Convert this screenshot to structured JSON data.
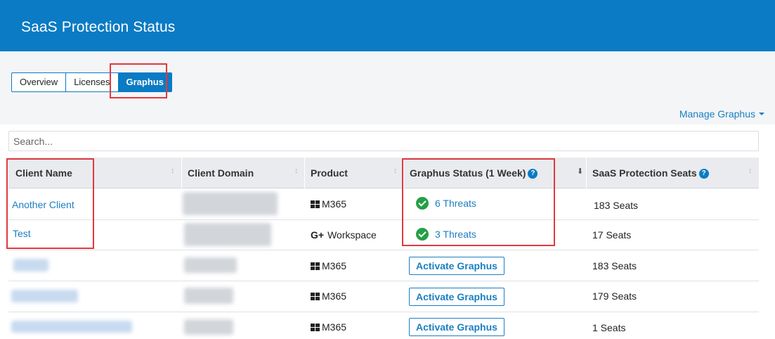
{
  "header": {
    "title": "SaaS Protection Status"
  },
  "tabs": [
    {
      "label": "Overview",
      "active": false
    },
    {
      "label": "Licenses",
      "active": false
    },
    {
      "label": "Graphus",
      "active": true
    }
  ],
  "manage_label": "Manage Graphus",
  "search": {
    "placeholder": "Search...",
    "value": ""
  },
  "table": {
    "columns": [
      "Client Name",
      "Client Domain",
      "Product",
      "Graphus Status (1 Week)",
      "SaaS Protection Seats"
    ],
    "rows": [
      {
        "client": "Another Client",
        "product": "M365",
        "product_icon": "windows-icon",
        "status": "6 Threats",
        "seats": "183 Seats"
      },
      {
        "client": "Test",
        "product": "Workspace",
        "product_icon": "google-plus-icon",
        "status": "3 Threats",
        "seats": "17 Seats"
      },
      {
        "client": "",
        "product": "M365",
        "product_icon": "windows-icon",
        "status": "Activate Graphus",
        "seats": "183 Seats"
      },
      {
        "client": "",
        "product": "M365",
        "product_icon": "windows-icon",
        "status": "Activate Graphus",
        "seats": "179 Seats"
      },
      {
        "client": "",
        "product": "M365",
        "product_icon": "windows-icon",
        "status": "Activate Graphus",
        "seats": "1 Seats"
      }
    ]
  },
  "colors": {
    "header_bg": "#0a7bc4",
    "link": "#1a7fc3",
    "ok_green": "#23a046",
    "highlight_red": "#e0393e"
  }
}
